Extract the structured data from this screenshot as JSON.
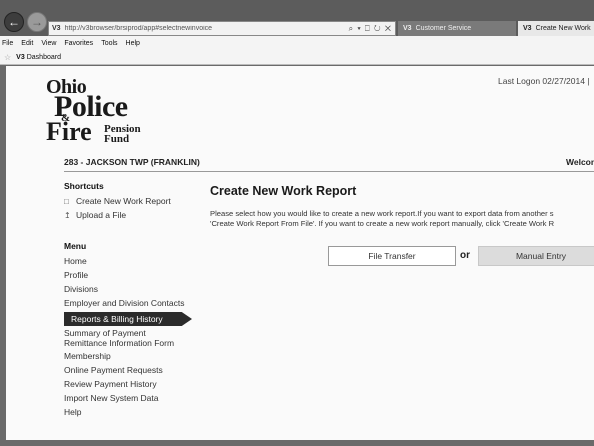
{
  "browser": {
    "address_icon": "V3",
    "url": "http://v3browser/brsiprod/app#selectnewinvoice",
    "address_tools": "⌕ ▾ ⎕ ↻ ✕",
    "tabs": [
      {
        "icon": "V3",
        "label": "Customer Service"
      },
      {
        "icon": "V3",
        "label": "Create New Work"
      }
    ],
    "menu": [
      "File",
      "Edit",
      "View",
      "Favorites",
      "Tools",
      "Help"
    ],
    "favorites": {
      "icon": "V3",
      "label": "Dashboard"
    }
  },
  "header": {
    "logo": {
      "ohio": "Ohio",
      "police": "Police",
      "amp": "&",
      "fire": "Fire",
      "pension": "Pension",
      "fund": "Fund"
    },
    "last_logon": "Last Logon 02/27/2014 |"
  },
  "employer": "283 - JACKSON TWP (FRANKLIN)",
  "welcome": "Welcom",
  "sidebar": {
    "shortcuts_heading": "Shortcuts",
    "shortcuts": [
      {
        "label": "Create New Work Report",
        "icon": "document-icon"
      },
      {
        "label": "Upload a File",
        "icon": "upload-icon"
      }
    ],
    "menu_heading": "Menu",
    "menu": [
      "Home",
      "Profile",
      "Divisions",
      "Employer and Division Contacts",
      "Reports & Billing History",
      "Summary of Payment",
      "Remittance Information Form",
      "Membership",
      "Online Payment Requests",
      "Review Payment History",
      "Import New System Data",
      "Help"
    ],
    "active_item": "Reports & Billing History"
  },
  "content": {
    "title": "Create New Work Report",
    "description_line1": "Please select how you would like to create a new work report.If you want to export data from another s",
    "description_line2": "'Create Work Report From File'. If you want to create a new work report manually, click 'Create Work R",
    "file_transfer_label": "File Transfer",
    "or_label": "or",
    "manual_entry_label": "Manual Entry"
  }
}
